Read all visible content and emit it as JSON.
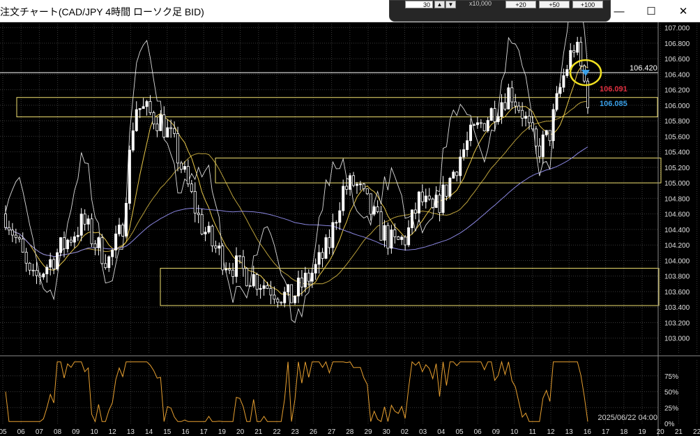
{
  "window": {
    "title": "注文チャート(CAD/JPY 4時間 ローソク足 BID)",
    "minimize_glyph": "—",
    "maximize_glyph": "☐",
    "close_glyph": "✕"
  },
  "toolbar": {
    "qty_value": "30",
    "spin_up": "▲",
    "spin_down": "▼",
    "multiplier": "x10,000",
    "buttons": [
      "+20",
      "+50",
      "+100"
    ]
  },
  "price_labels": {
    "line_price": "106.420",
    "ask": "106.091",
    "bid": "106.085"
  },
  "timestamp": "2025/06/22 04:00",
  "colors": {
    "background": "#000000",
    "grid": "#3a3a3a",
    "candles": "#ffffff",
    "ma_short": "#e8c84a",
    "ma_long": "#8a86e0",
    "oscillator": "#e8a030",
    "zones": "#f0e070",
    "ask": "#e03040",
    "bid": "#3aa0e8",
    "highlight_circle": "#f0e020"
  },
  "chart_data": {
    "type": "candlestick",
    "instrument": "CAD/JPY",
    "timeframe": "4時間",
    "price_type": "BID",
    "y_ticks": [
      "107.000",
      "106.800",
      "106.600",
      "106.400",
      "106.200",
      "106.000",
      "105.800",
      "105.600",
      "105.400",
      "105.200",
      "105.000",
      "104.800",
      "104.600",
      "104.400",
      "104.200",
      "104.000",
      "103.800",
      "103.600",
      "103.400",
      "103.200",
      "103.000"
    ],
    "ylim": [
      102.8,
      107.05
    ],
    "x_ticks": [
      "05",
      "06",
      "07",
      "08",
      "09",
      "10",
      "12",
      "13",
      "14",
      "15",
      "16",
      "17",
      "19",
      "20",
      "21",
      "22",
      "23",
      "26",
      "27",
      "28",
      "29",
      "30",
      "02",
      "03",
      "04",
      "05",
      "06",
      "09",
      "10",
      "11",
      "12",
      "13",
      "16",
      "17",
      "18",
      "19",
      "20",
      "21",
      "22"
    ],
    "horizontal_line": 106.42,
    "zones": [
      [
        105.85,
        106.1
      ],
      [
        105.0,
        105.32
      ],
      [
        103.42,
        103.9
      ]
    ],
    "last_bid": 106.085,
    "last_ask": 106.091,
    "oscillator_ticks": [
      "75%",
      "50%",
      "25%",
      "0%"
    ],
    "oscillator_range": [
      0,
      100
    ]
  }
}
